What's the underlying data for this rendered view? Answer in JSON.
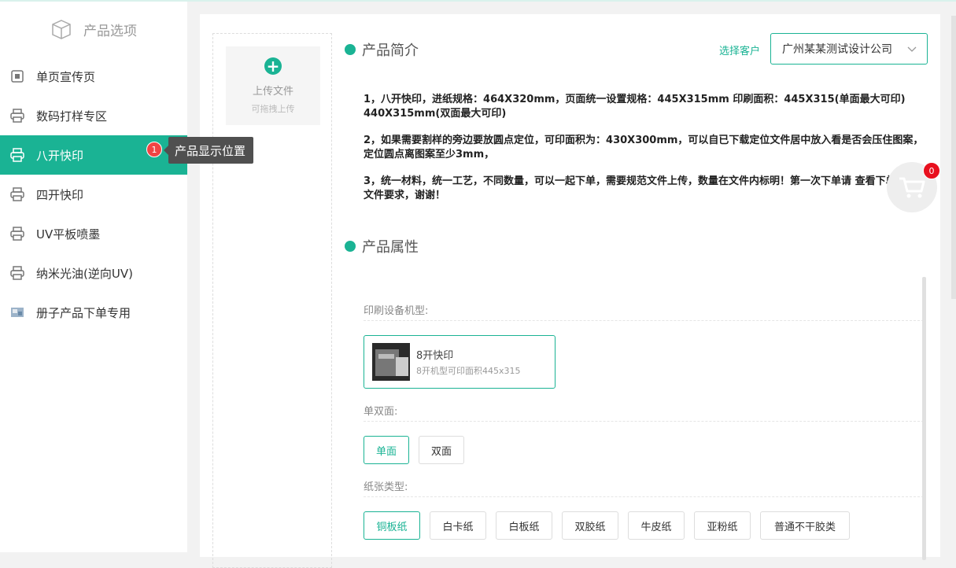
{
  "sidebar": {
    "title": "产品选项",
    "items": [
      {
        "label": "单页宣传页",
        "icon": "square-icon"
      },
      {
        "label": "数码打样专区",
        "icon": "printer-icon"
      },
      {
        "label": "八开快印",
        "icon": "printer-icon",
        "active": true
      },
      {
        "label": "四开快印",
        "icon": "printer-icon"
      },
      {
        "label": "UV平板喷墨",
        "icon": "printer-icon"
      },
      {
        "label": "纳米光油(逆向UV)",
        "icon": "printer-icon"
      },
      {
        "label": "册子产品下单专用",
        "icon": "thumbnail-image"
      }
    ],
    "badge_count": "1",
    "tooltip": "产品显示位置"
  },
  "upload": {
    "label": "上传文件",
    "hint": "可拖拽上传"
  },
  "intro": {
    "title": "产品简介",
    "paragraphs": [
      "1，八开快印，进纸规格：464X320mm，页面统一设置规格：445X315mm  印刷面积：445X315(单面最大可印)  440X315mm(双面最大可印)",
      "2，如果需要割样的旁边要放圆点定位，可印面积为：430X300mm，可以自已下载定位文件居中放入看是否会压住图案，定位圆点离图案至少3mm，",
      "3，统一材料，统一工艺，不同数量，可以一起下单，需要规范文件上传，数量在文件内标明！第一次下单请    查看下单规范文件要求，谢谢！"
    ]
  },
  "customer": {
    "label": "选择客户",
    "selected": "广州某某测试设计公司"
  },
  "attributes": {
    "title": "产品属性",
    "machine_label": "印刷设备机型:",
    "machine": {
      "name": "8开快印",
      "desc": "8开机型可印面积445x315"
    },
    "sides_label": "单双面:",
    "sides": [
      "单面",
      "双面"
    ],
    "sides_selected": "单面",
    "paper_label": "纸张类型:",
    "papers": [
      "铜板纸",
      "白卡纸",
      "白板纸",
      "双胶纸",
      "牛皮纸",
      "亚粉纸",
      "普通不干胶类"
    ],
    "paper_selected": "铜板纸"
  },
  "cart": {
    "count": "0"
  },
  "colors": {
    "accent": "#1ab394",
    "badge": "#f04444"
  }
}
